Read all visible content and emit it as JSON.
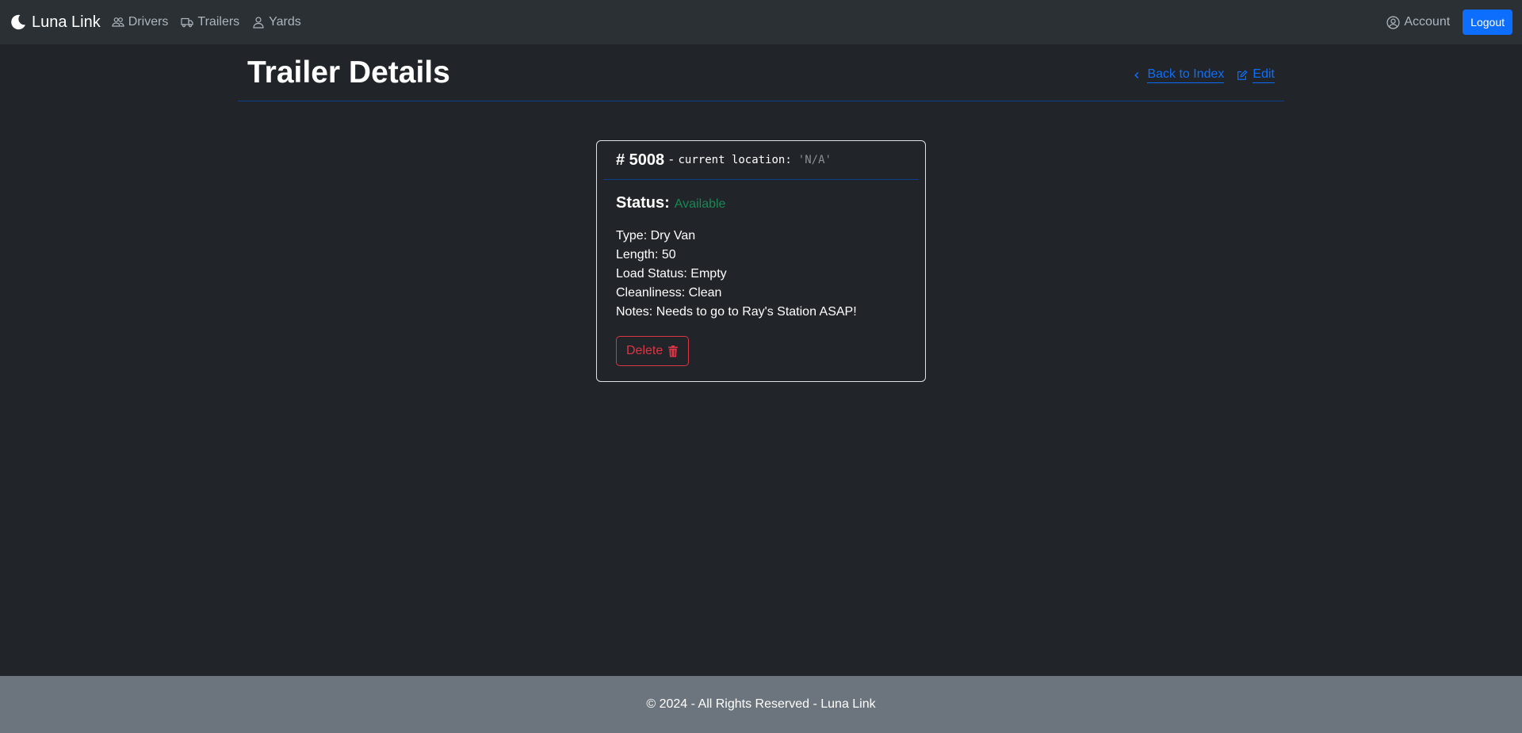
{
  "navbar": {
    "brand": "Luna Link",
    "links": [
      {
        "label": "Drivers",
        "icon": "people-icon"
      },
      {
        "label": "Trailers",
        "icon": "truck-icon"
      },
      {
        "label": "Yards",
        "icon": "person-icon"
      }
    ],
    "account_label": "Account",
    "logout_label": "Logout"
  },
  "header": {
    "title": "Trailer Details",
    "back_label": "Back to Index",
    "edit_label": "Edit"
  },
  "card": {
    "number": "# 5008",
    "dash": "-",
    "location_label": "current location:",
    "location_value": "'N/A'",
    "status_label": "Status:",
    "status_value": "Available",
    "details": [
      "Type: Dry Van",
      "Length: 50",
      "Load Status: Empty",
      "Cleanliness: Clean",
      "Notes: Needs to go to Ray's Station ASAP!"
    ],
    "delete_label": "Delete"
  },
  "footer": {
    "text": "© 2024 - All Rights Reserved - Luna Link"
  },
  "colors": {
    "background": "#212529",
    "navbar": "#2b3035",
    "primary": "#0d6efd",
    "success": "#198754",
    "danger": "#dc3545",
    "footer": "#6c757d"
  }
}
